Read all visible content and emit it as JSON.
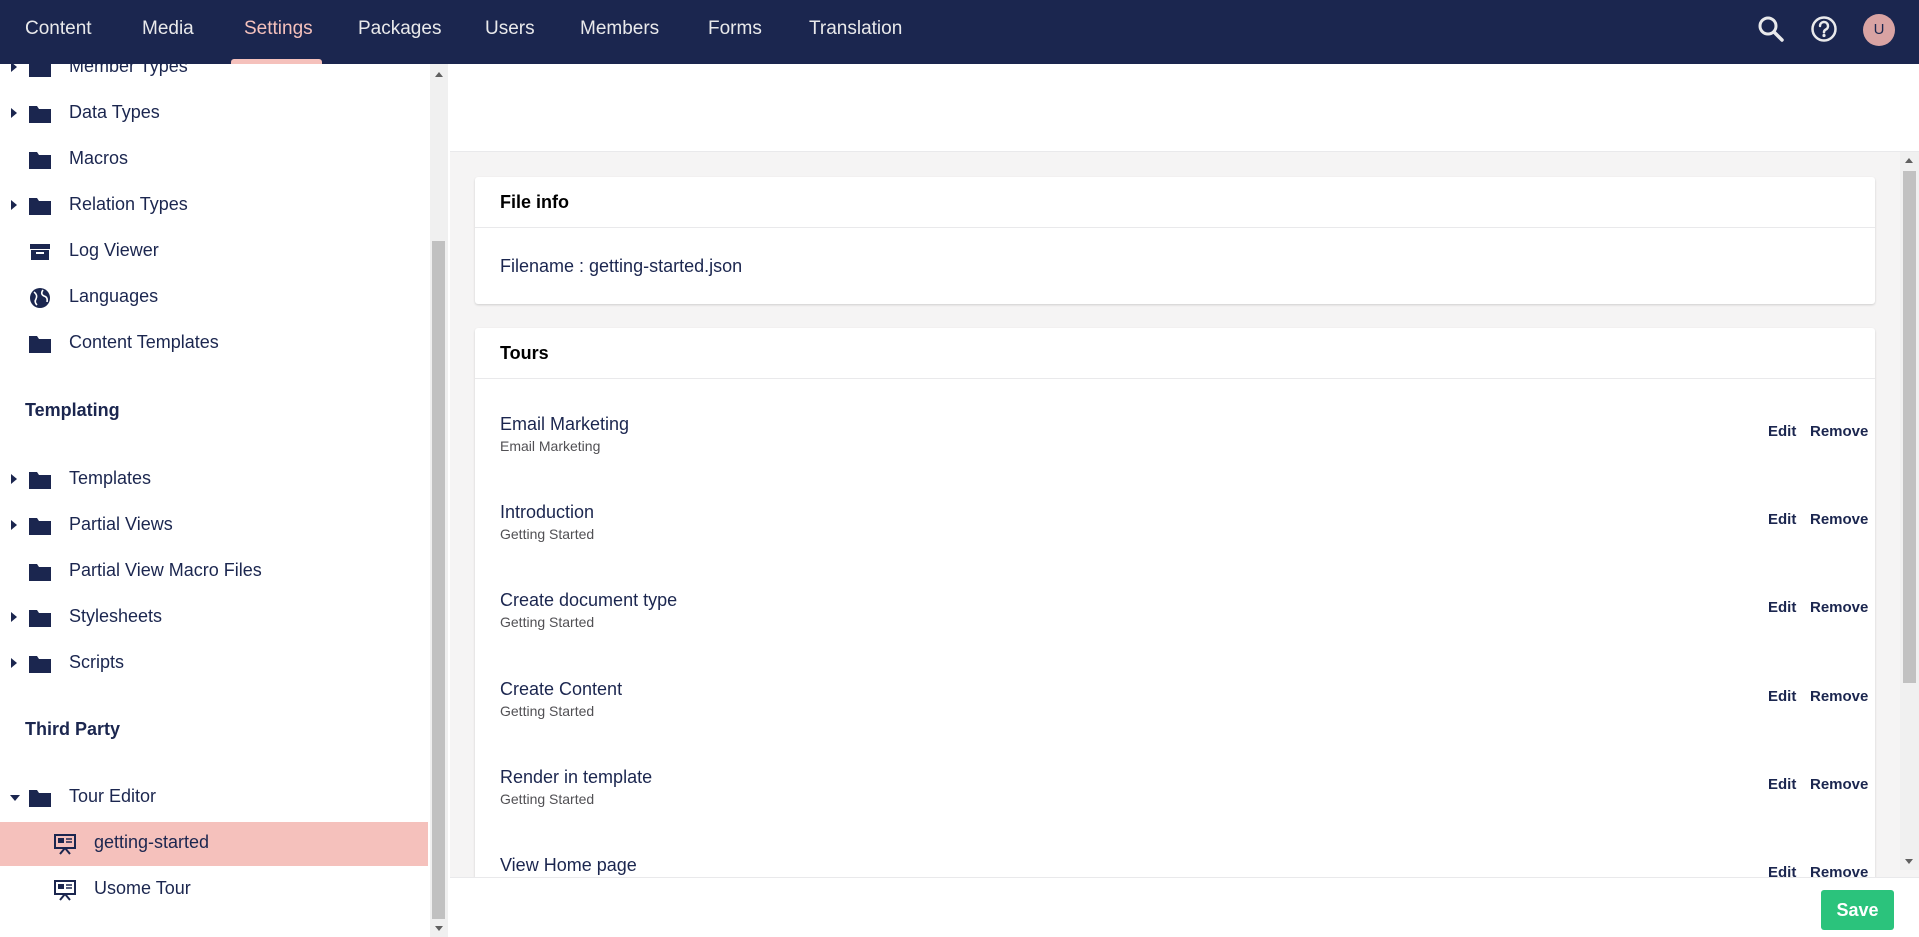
{
  "nav": {
    "items": [
      "Content",
      "Media",
      "Settings",
      "Packages",
      "Users",
      "Members",
      "Forms",
      "Translation"
    ],
    "active": "Settings",
    "avatar_initial": "U"
  },
  "sidebar": {
    "items_top": [
      {
        "label": "Member Types",
        "icon": "folder-icon",
        "expandable": true
      },
      {
        "label": "Data Types",
        "icon": "folder-icon",
        "expandable": true
      },
      {
        "label": "Macros",
        "icon": "folder-icon",
        "expandable": false
      },
      {
        "label": "Relation Types",
        "icon": "folder-icon",
        "expandable": true
      },
      {
        "label": "Log Viewer",
        "icon": "archive-icon",
        "expandable": false
      },
      {
        "label": "Languages",
        "icon": "globe-icon",
        "expandable": false
      },
      {
        "label": "Content Templates",
        "icon": "folder-icon",
        "expandable": false
      }
    ],
    "section_templating": "Templating",
    "items_templating": [
      {
        "label": "Templates",
        "icon": "folder-icon",
        "expandable": true
      },
      {
        "label": "Partial Views",
        "icon": "folder-icon",
        "expandable": true
      },
      {
        "label": "Partial View Macro Files",
        "icon": "folder-icon",
        "expandable": false
      },
      {
        "label": "Stylesheets",
        "icon": "folder-icon",
        "expandable": true
      },
      {
        "label": "Scripts",
        "icon": "folder-icon",
        "expandable": true
      }
    ],
    "section_third_party": "Third Party",
    "tour_editor": {
      "label": "Tour Editor",
      "icon": "folder-icon",
      "expanded": true
    },
    "tour_children": [
      {
        "label": "getting-started",
        "icon": "presentation-icon",
        "selected": true
      },
      {
        "label": "Usome Tour",
        "icon": "presentation-icon",
        "selected": false
      }
    ]
  },
  "file_info": {
    "heading": "File info",
    "filename_line": "Filename : getting-started.json"
  },
  "tours": {
    "heading": "Tours",
    "edit_label": "Edit",
    "remove_label": "Remove",
    "items": [
      {
        "name": "Email Marketing",
        "group": "Email Marketing"
      },
      {
        "name": "Introduction",
        "group": "Getting Started"
      },
      {
        "name": "Create document type",
        "group": "Getting Started"
      },
      {
        "name": "Create Content",
        "group": "Getting Started"
      },
      {
        "name": "Render in template",
        "group": "Getting Started"
      },
      {
        "name": "View Home page",
        "group": ""
      }
    ]
  },
  "footer": {
    "save_label": "Save"
  },
  "colors": {
    "nav_bg": "#1b264f",
    "accent": "#f5c1bc",
    "save": "#2bc37c"
  }
}
